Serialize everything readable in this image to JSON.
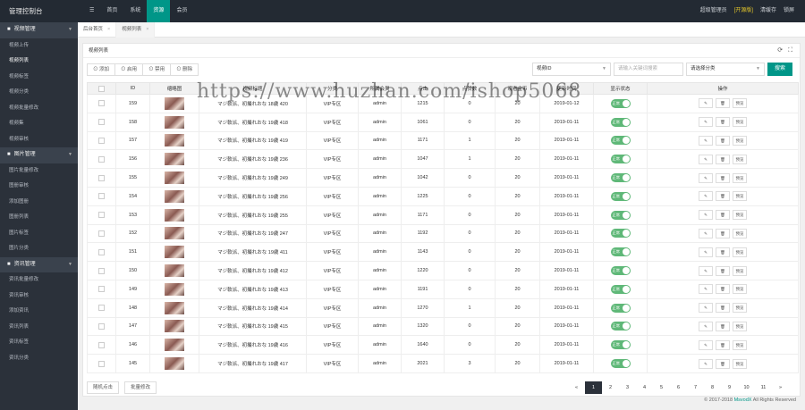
{
  "app": {
    "brand": "管理控制台"
  },
  "topnav": {
    "home_icon": "menu-icon",
    "items": [
      {
        "label": "首页"
      },
      {
        "label": "系统"
      },
      {
        "label": "资源"
      },
      {
        "label": "会员"
      }
    ],
    "active_index": 2
  },
  "topright": {
    "user": "超级管理员",
    "badge": "[开源版]",
    "clear": "清缓存",
    "logout": "锁屏"
  },
  "sidebar": {
    "groups": [
      {
        "label": "视频管理",
        "icon": "video-icon",
        "items": [
          "视频上传",
          "视频列表",
          "视频标签",
          "视频分类",
          "视频批量修改",
          "视频集",
          "视频审核"
        ]
      },
      {
        "label": "图片管理",
        "icon": "image-icon",
        "items": [
          "图片批量修改",
          "图册审核",
          "添加图册",
          "图册列表",
          "图片标签",
          "图片分类"
        ]
      },
      {
        "label": "资讯管理",
        "icon": "news-icon",
        "items": [
          "资讯批量修改",
          "资讯审核",
          "添加资讯",
          "资讯列表",
          "资讯标签",
          "资讯分类"
        ]
      }
    ],
    "active_item": "视频列表"
  },
  "tabs": [
    {
      "label": "后台首页"
    },
    {
      "label": "视频列表"
    }
  ],
  "panel": {
    "title": "视频列表",
    "toolbar": [
      {
        "label": "添加"
      },
      {
        "label": "启用"
      },
      {
        "label": "禁用"
      },
      {
        "label": "删除"
      }
    ],
    "filter": {
      "field": "视频ID",
      "placeholder": "请输入关键词搜索",
      "category": "请选择分类",
      "search": "搜索"
    },
    "columns": [
      "",
      "ID",
      "缩略图",
      "视频标题",
      "分类",
      "所属会员",
      "点击",
      "点赞数",
      "观看金币",
      "更新时间",
      "显示状态",
      "操作"
    ],
    "rows": [
      {
        "id": "159",
        "title": "マジ軟派、初撮れおな 18歳 420",
        "cat": "VIP专区",
        "member": "admin",
        "clicks": "1215",
        "likes": "0",
        "gold": "20",
        "time": "2019-01-12"
      },
      {
        "id": "158",
        "title": "マジ軟派、初撮れおな 19歳 418",
        "cat": "VIP专区",
        "member": "admin",
        "clicks": "1061",
        "likes": "0",
        "gold": "20",
        "time": "2019-01-11"
      },
      {
        "id": "157",
        "title": "マジ軟派、初撮れおな 19歳 419",
        "cat": "VIP专区",
        "member": "admin",
        "clicks": "1171",
        "likes": "1",
        "gold": "20",
        "time": "2019-01-11"
      },
      {
        "id": "156",
        "title": "マジ軟派、初撮れおな 19歳 236",
        "cat": "VIP专区",
        "member": "admin",
        "clicks": "1047",
        "likes": "1",
        "gold": "20",
        "time": "2019-01-11"
      },
      {
        "id": "155",
        "title": "マジ軟派、初撮れおな 19歳 249",
        "cat": "VIP专区",
        "member": "admin",
        "clicks": "1042",
        "likes": "0",
        "gold": "20",
        "time": "2019-01-11"
      },
      {
        "id": "154",
        "title": "マジ軟派、初撮れおな 19歳 256",
        "cat": "VIP专区",
        "member": "admin",
        "clicks": "1225",
        "likes": "0",
        "gold": "20",
        "time": "2019-01-11"
      },
      {
        "id": "153",
        "title": "マジ軟派、初撮れおな 19歳 255",
        "cat": "VIP专区",
        "member": "admin",
        "clicks": "1171",
        "likes": "0",
        "gold": "20",
        "time": "2019-01-11"
      },
      {
        "id": "152",
        "title": "マジ軟派、初撮れおな 19歳 247",
        "cat": "VIP专区",
        "member": "admin",
        "clicks": "1192",
        "likes": "0",
        "gold": "20",
        "time": "2019-01-11"
      },
      {
        "id": "151",
        "title": "マジ軟派、初撮れおな 19歳 411",
        "cat": "VIP专区",
        "member": "admin",
        "clicks": "1143",
        "likes": "0",
        "gold": "20",
        "time": "2019-01-11"
      },
      {
        "id": "150",
        "title": "マジ軟派、初撮れおな 19歳 412",
        "cat": "VIP专区",
        "member": "admin",
        "clicks": "1220",
        "likes": "0",
        "gold": "20",
        "time": "2019-01-11"
      },
      {
        "id": "149",
        "title": "マジ軟派、初撮れおな 19歳 413",
        "cat": "VIP专区",
        "member": "admin",
        "clicks": "1191",
        "likes": "0",
        "gold": "20",
        "time": "2019-01-11"
      },
      {
        "id": "148",
        "title": "マジ軟派、初撮れおな 19歳 414",
        "cat": "VIP专区",
        "member": "admin",
        "clicks": "1270",
        "likes": "1",
        "gold": "20",
        "time": "2019-01-11"
      },
      {
        "id": "147",
        "title": "マジ軟派、初撮れおな 19歳 415",
        "cat": "VIP专区",
        "member": "admin",
        "clicks": "1320",
        "likes": "0",
        "gold": "20",
        "time": "2019-01-11"
      },
      {
        "id": "146",
        "title": "マジ軟派、初撮れおな 19歳 416",
        "cat": "VIP专区",
        "member": "admin",
        "clicks": "1640",
        "likes": "0",
        "gold": "20",
        "time": "2019-01-11"
      },
      {
        "id": "145",
        "title": "マジ軟派、初撮れおな 19歳 417",
        "cat": "VIP专区",
        "member": "admin",
        "clicks": "2021",
        "likes": "3",
        "gold": "20",
        "time": "2019-01-11"
      }
    ],
    "status_label": "正常",
    "ops": [
      "✎",
      "🗑",
      "预览"
    ],
    "footer": {
      "b1": "随机点击",
      "b2": "批量修改"
    },
    "pager": [
      "«",
      "1",
      "2",
      "3",
      "4",
      "5",
      "6",
      "7",
      "8",
      "9",
      "10",
      "11",
      "»"
    ],
    "pager_active": 1
  },
  "copyright": {
    "pre": "© 2017-2018 ",
    "link": "MsvodX",
    "post": " All Rights Reserved"
  },
  "watermark": "https://www.huzhan.com/ishop5068",
  "colors": {
    "accent": "#009688",
    "topbar": "#232a33",
    "sidebar": "#2b313a",
    "switch_on": "#5fb878"
  }
}
